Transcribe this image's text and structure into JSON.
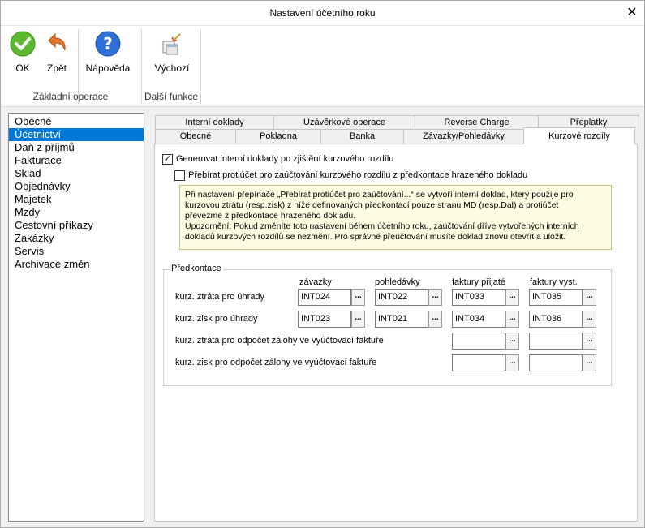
{
  "window": {
    "title": "Nastavení účetního roku"
  },
  "ribbon": {
    "ok": "OK",
    "back": "Zpět",
    "help": "Nápověda",
    "default": "Výchozí",
    "group_basic": "Základní operace",
    "group_more": "Další funkce"
  },
  "sidebar": {
    "items": [
      "Obecné",
      "Účetnictví",
      "Daň z příjmů",
      "Fakturace",
      "Sklad",
      "Objednávky",
      "Majetek",
      "Mzdy",
      "Cestovní příkazy",
      "Zakázky",
      "Servis",
      "Archivace změn"
    ],
    "selected_index": 1
  },
  "tabs": {
    "row1": [
      "Interní doklady",
      "Uzávěrkové operace",
      "Reverse Charge",
      "Přeplatky"
    ],
    "row2": [
      "Obecné",
      "Pokladna",
      "Banka",
      "Závazky/Pohledávky",
      "Kurzové rozdíly"
    ],
    "active": "Kurzové rozdíly"
  },
  "panel": {
    "cb_generate": {
      "label": "Generovat interní doklady po zjištění kurzového rozdílu",
      "checked": true
    },
    "cb_take": {
      "label": "Přebírat protiúčet pro zaúčtování kurzového rozdílu z předkontace hrazeného dokladu",
      "checked": false
    },
    "note_lines": [
      "Při nastavení přepínače „Přebírat protiúčet pro zaúčtování...“  se vytvoří interní doklad, který použije pro",
      "kurzovou ztrátu (resp.zisk) z níže definovaných předkontací pouze stranu MD (resp.Dal) a protiúčet",
      "převezme z předkontace hrazeného dokladu.",
      "Upozornění: Pokud změníte toto nastavení během účetního roku, zaúčtování dříve vytvořených interních",
      "dokladů kurzových rozdílů se nezmění. Pro správné přeúčtování musíte doklad znovu otevřít a uložit."
    ],
    "predkontace": {
      "legend": "Předkontace",
      "columns": [
        "závazky",
        "pohledávky",
        "faktury přijaté",
        "faktury vyst."
      ],
      "rows": [
        {
          "label": "kurz. ztráta pro úhrady",
          "values": [
            "INT024",
            "INT022",
            "INT033",
            "INT035"
          ]
        },
        {
          "label": "kurz. zisk pro úhrady",
          "values": [
            "INT023",
            "INT021",
            "INT034",
            "INT036"
          ]
        },
        {
          "label": "kurz. ztráta pro odpočet zálohy ve vyúčtovací faktuře",
          "values": [
            "",
            "",
            "",
            ""
          ]
        },
        {
          "label": "kurz. zisk pro odpočet zálohy ve vyúčtovací faktuře",
          "values": [
            "",
            "",
            "",
            ""
          ]
        }
      ],
      "browse_label": "..."
    }
  },
  "colors": {
    "selection": "#0078d7",
    "note_bg": "#fffde1"
  }
}
